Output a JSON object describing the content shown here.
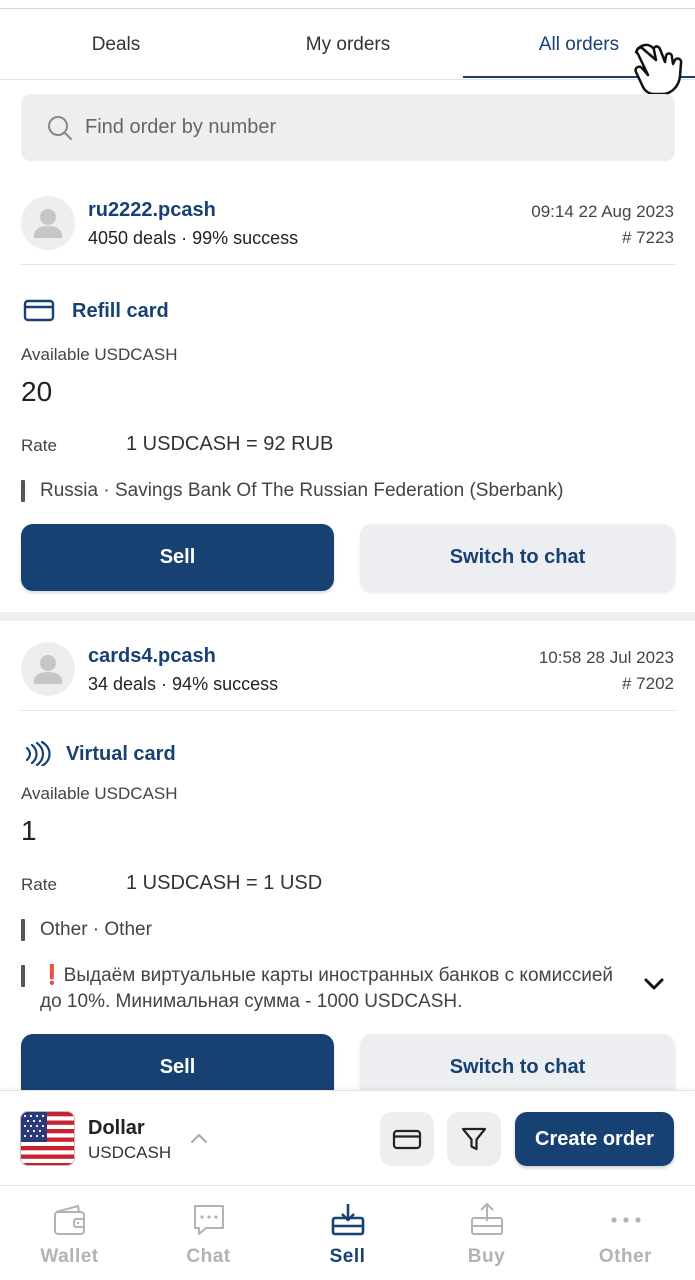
{
  "tabs": [
    {
      "label": "Deals"
    },
    {
      "label": "My orders"
    },
    {
      "label": "All orders"
    }
  ],
  "search": {
    "placeholder": "Find order by number"
  },
  "orders": [
    {
      "username": "ru2222.pcash",
      "stats": "4050 deals · 99% success",
      "datetime": "09:14 22 Aug 2023",
      "order_number": "# 7223",
      "type_label": "Refill card",
      "type_icon": "card-icon",
      "available_label": "Available USDCASH",
      "available_value": "20",
      "rate_label": "Rate",
      "rate_value": "1 USDCASH = 92 RUB",
      "bank": "Russia · Savings Bank Of The Russian Federation (Sberbank)",
      "sell_label": "Sell",
      "chat_label": "Switch to chat"
    },
    {
      "username": "cards4.pcash",
      "stats": "34 deals · 94% success",
      "datetime": "10:58 28 Jul 2023",
      "order_number": "# 7202",
      "type_label": "Virtual card",
      "type_icon": "nfc-icon",
      "available_label": "Available USDCASH",
      "available_value": "1",
      "rate_label": "Rate",
      "rate_value": "1 USDCASH = 1 USD",
      "bank": "Other · Other",
      "note_mark": "❗",
      "note": "Выдаём виртуальные карты иностранных банков с комиссией до 10%. Минимальная сумма - 1000 USDCASH.",
      "sell_label": "Sell",
      "chat_label": "Switch to chat"
    }
  ],
  "bottom_bar": {
    "currency_name": "Dollar",
    "currency_code": "USDCASH",
    "create_label": "Create order"
  },
  "nav": [
    {
      "label": "Wallet",
      "icon": "wallet-icon"
    },
    {
      "label": "Chat",
      "icon": "chat-icon"
    },
    {
      "label": "Sell",
      "icon": "sell-icon",
      "active": true
    },
    {
      "label": "Buy",
      "icon": "buy-icon"
    },
    {
      "label": "Other",
      "icon": "more-icon"
    }
  ],
  "colors": {
    "primary": "#174173",
    "muted": "#b3b3b3",
    "surface": "#eeeeee",
    "alert": "#d11f1f"
  }
}
